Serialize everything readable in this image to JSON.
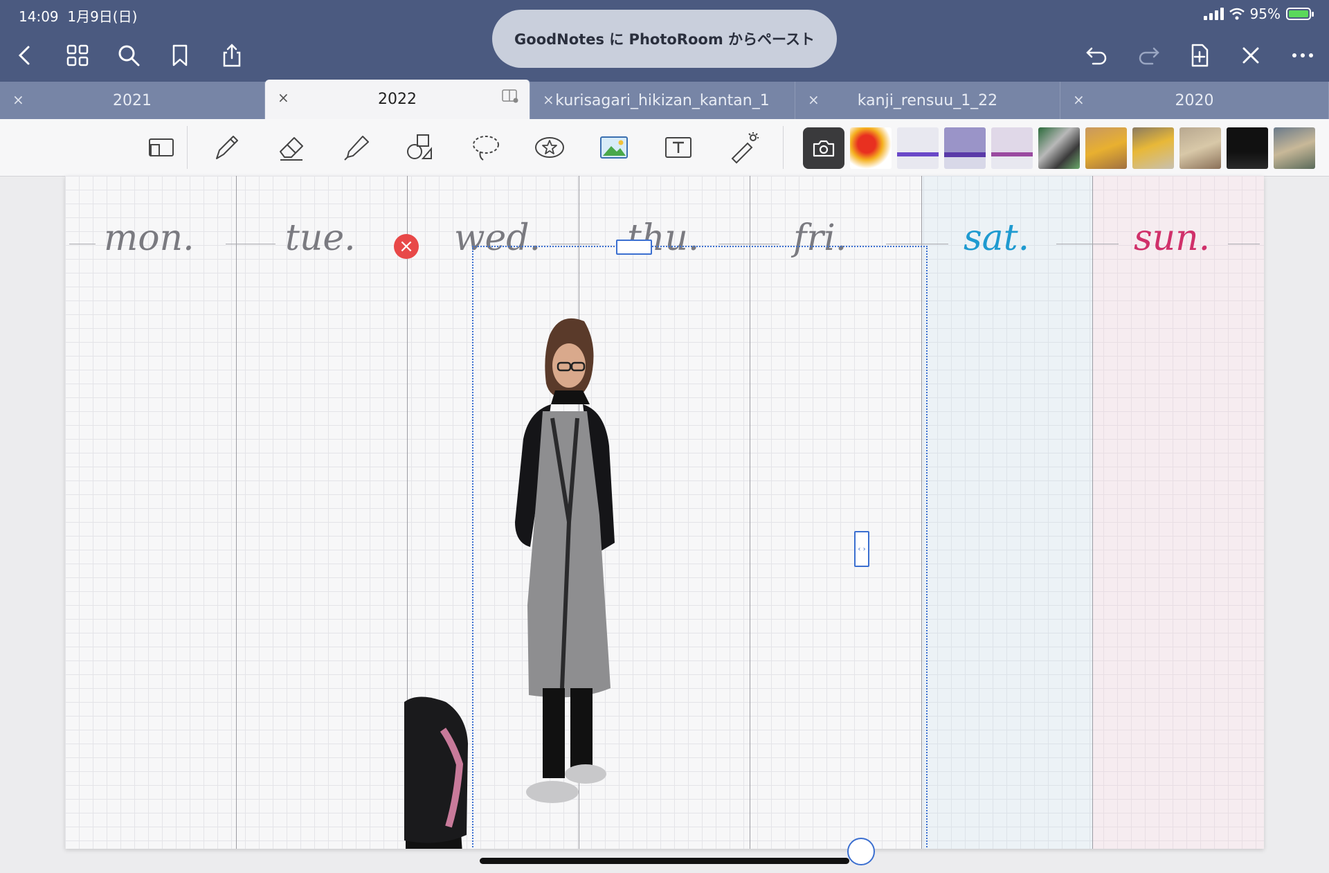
{
  "status": {
    "time": "14:09",
    "date": "1月9日(日)",
    "battery": "95%"
  },
  "toast": "GoodNotes に PhotoRoom からペースト",
  "tabs": [
    {
      "label": "2021",
      "close": "×",
      "active": false
    },
    {
      "label": "2022",
      "close": "×",
      "active": true
    },
    {
      "label": "kurisagari_hikizan_kantan_1",
      "close": "×",
      "active": false
    },
    {
      "label": "kanji_rensuu_1_22",
      "close": "×",
      "active": false
    },
    {
      "label": "2020",
      "close": "×",
      "active": false
    }
  ],
  "planner": {
    "days": [
      "mon.",
      "tue.",
      "wed.",
      "thu.",
      "fri.",
      "sat.",
      "sun."
    ],
    "colors": {
      "weekday": "#7a7a80",
      "sat": "#1e9ad0",
      "sun": "#d0306a"
    }
  },
  "selection": {
    "delete_glyph": "×",
    "resize_glyph": "‹ ›"
  },
  "icons": {
    "nav_left": [
      "back-icon",
      "grid-icon",
      "search-icon",
      "bookmark-icon",
      "share-icon"
    ],
    "nav_right": [
      "undo-icon",
      "redo-icon",
      "add-page-icon",
      "close-edit-icon",
      "more-icon"
    ],
    "tools": [
      "zoom-window-icon",
      "pen-icon",
      "eraser-icon",
      "highlighter-icon",
      "shapes-icon",
      "lasso-icon",
      "elements-icon",
      "image-icon",
      "text-icon",
      "laser-pointer-icon"
    ]
  }
}
